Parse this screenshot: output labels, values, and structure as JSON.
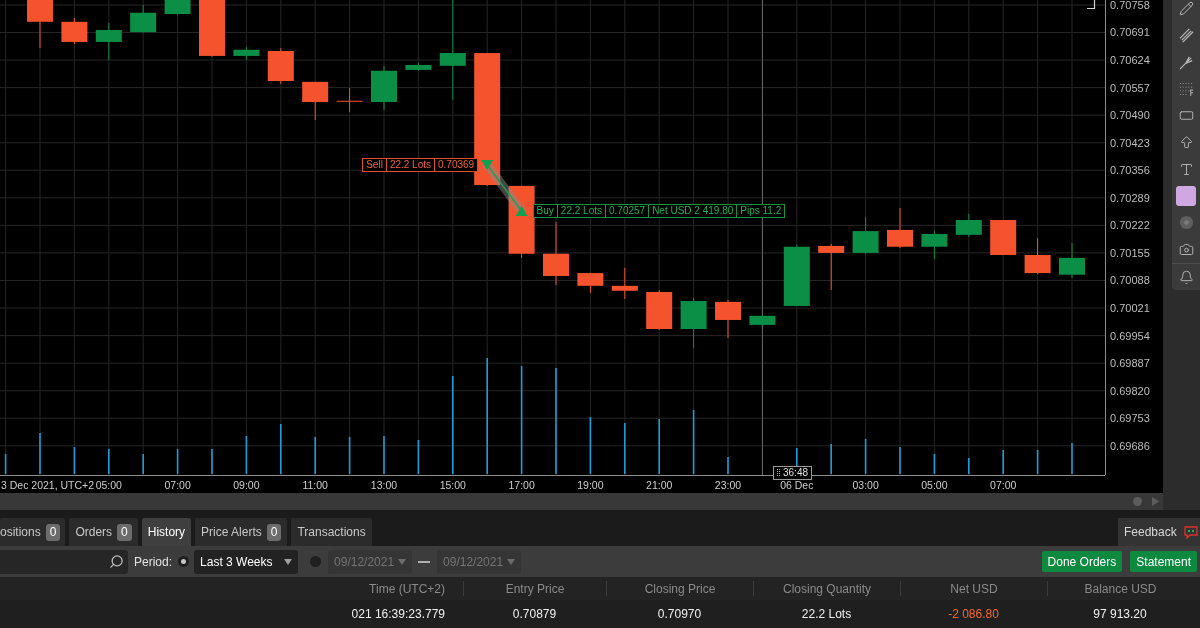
{
  "chart": {
    "price_axis": [
      "0.70758",
      "0.70691",
      "0.70624",
      "0.70557",
      "0.70490",
      "0.70423",
      "0.70356",
      "0.70289",
      "0.70222",
      "0.70155",
      "0.70088",
      "0.70021",
      "0.69954",
      "0.69887",
      "0.69820",
      "0.69753",
      "0.69686"
    ],
    "time_axis": {
      "date": "3 Dec 2021, UTC+2",
      "labels": [
        "05:00",
        "07:00",
        "09:00",
        "11:00",
        "13:00",
        "15:00",
        "17:00",
        "19:00",
        "21:00",
        "23:00",
        "06 Dec",
        "03:00",
        "05:00",
        "07:00"
      ]
    },
    "trades": [
      {
        "kind": "sell",
        "fields": [
          "Sell",
          "22.2 Lots",
          "0.70369"
        ]
      },
      {
        "kind": "buy",
        "fields": [
          "Buy",
          "22.2 Lots",
          "0.70257",
          "Net USD 2 419.80",
          "Pips 11.2"
        ]
      }
    ],
    "timer": "36:48"
  },
  "bottom_panel": {
    "tabs": [
      {
        "label": "ositions",
        "count": "0",
        "selected": false
      },
      {
        "label": "Orders",
        "count": "0",
        "selected": false
      },
      {
        "label": "History",
        "selected": true
      },
      {
        "label": "Price Alerts",
        "count": "0",
        "selected": false
      },
      {
        "label": "Transactions",
        "selected": false
      }
    ],
    "feedback": {
      "label": "Feedback"
    },
    "filter": {
      "period_label": "Period:",
      "options": [
        {
          "kind": "preset",
          "selected": true,
          "value": "Last 3 Weeks"
        },
        {
          "kind": "range",
          "selected": false,
          "from": "09/12/2021",
          "to": "09/12/2021"
        }
      ]
    },
    "actions": [
      "Done Orders",
      "Statement"
    ],
    "table": {
      "columns": [
        "Time (UTC+2)",
        "Entry Price",
        "Closing Price",
        "Closing Quantity",
        "Net USD",
        "Balance USD"
      ],
      "rows": [
        {
          "cells": [
            {
              "text": "021 16:39:23.779",
              "negative": false
            },
            {
              "text": "0.70879",
              "negative": false
            },
            {
              "text": "0.70970",
              "negative": false
            },
            {
              "text": "22.2 Lots",
              "negative": false
            },
            {
              "text": "-2 086.80",
              "negative": true
            },
            {
              "text": "97 913.20",
              "negative": false
            }
          ]
        }
      ]
    }
  }
}
